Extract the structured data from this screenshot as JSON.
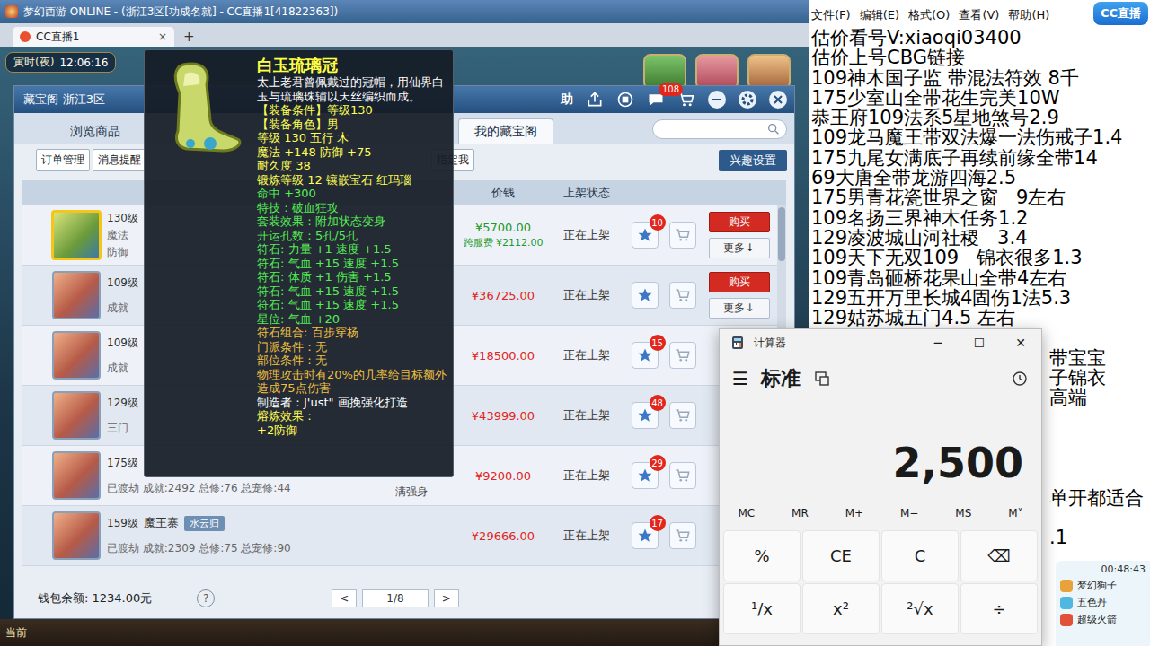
{
  "game": {
    "title": "梦幻西游 ONLINE - (浙江3区[功成名就] - CC直播1[41822363])",
    "browser_tab": "CC直播1",
    "tab_close": "×",
    "new_tab": "+",
    "clock": {
      "period": "寅时(夜)",
      "time": "12:06:16"
    },
    "bottom_label": "当前"
  },
  "cbg": {
    "title": "藏宝阁-浙江3区",
    "help": "助",
    "message_badge": "108",
    "tabs": [
      {
        "label": "浏览商品",
        "selected": false
      },
      {
        "label": "我的藏宝阁",
        "selected": true
      }
    ],
    "sub_tabs": [
      "订单管理",
      "消息提醒",
      "指定我"
    ],
    "interest_button": "兴趣设置",
    "columns": [
      "价钱",
      "上架状态"
    ],
    "rows": [
      {
        "level": "130级",
        "details": [
          "魔法",
          "防御"
        ],
        "price": "¥5700.00",
        "fee": "跨服费 ¥2112.00",
        "price_color": "#1c9a2c",
        "status": "正在上架",
        "favorites": "10",
        "actions": [
          "购买",
          "更多↓"
        ],
        "selected": true
      },
      {
        "level": "109级",
        "details": [
          "成就"
        ],
        "price": "¥36725.00",
        "price_color": "#e2261c",
        "status": "正在上架",
        "actions": [
          "购买",
          "更多↓"
        ],
        "selected": false
      },
      {
        "level": "109级",
        "details": [
          "成就"
        ],
        "price": "¥18500.00",
        "price_color": "#e2261c",
        "status": "正在上架",
        "favorites": "15",
        "actions": [],
        "selected": false
      },
      {
        "level": "129级",
        "details": [
          "三门"
        ],
        "price": "¥43999.00",
        "price_color": "#e2261c",
        "status": "正在上架",
        "favorites": "48",
        "actions": [],
        "selected": false
      },
      {
        "level": "175级",
        "details": [
          "已渡劫 成就:2492 总修:76 总宠修:44"
        ],
        "extra": "满强身",
        "price": "¥9200.00",
        "price_color": "#e2261c",
        "status": "正在上架",
        "favorites": "29",
        "actions": [],
        "selected": false
      },
      {
        "level": "159级",
        "school": "魔王寨",
        "tag": "水云归",
        "details": [
          "已渡劫 成就:2309 总修:75 总宠修:90"
        ],
        "price": "¥29666.00",
        "price_color": "#e2261c",
        "status": "正在上架",
        "favorites": "17",
        "actions": [],
        "selected": false
      }
    ],
    "wallet": "钱包余额: 1234.00元",
    "help_mark": "?",
    "prev": "<",
    "page": "1/8",
    "next": ">"
  },
  "tooltip": {
    "name": "白玉琉璃冠",
    "description": "太上老君曾佩戴过的冠帽，用仙界白玉与琉璃珠辅以天丝编织而成。",
    "lines": [
      {
        "text": "【装备条件】等级130",
        "color": "#ffff55"
      },
      {
        "text": "【装备角色】男",
        "color": "#ffff55"
      },
      {
        "text": "等级 130  五行 木",
        "color": "#ffff55"
      },
      {
        "text": "魔法 +148 防御 +75",
        "color": "#ffff55"
      },
      {
        "text": "耐久度 38",
        "color": "#ffff55"
      },
      {
        "text": "锻炼等级 12  镶嵌宝石 红玛瑙",
        "color": "#ffff55"
      },
      {
        "text": "命中 +300",
        "color": "#55ee55"
      },
      {
        "text": "特技：破血狂攻",
        "color": "#55ee55"
      },
      {
        "text": "套装效果：附加状态变身",
        "color": "#55ee55"
      },
      {
        "text": "开运孔数：5孔/5孔",
        "color": "#55ee55"
      },
      {
        "text": "符石: 力量 +1 速度 +1.5",
        "color": "#55ee55"
      },
      {
        "text": "符石: 气血 +15 速度 +1.5",
        "color": "#55ee55"
      },
      {
        "text": "符石: 体质 +1 伤害 +1.5",
        "color": "#55ee55"
      },
      {
        "text": "符石: 气血 +15 速度 +1.5",
        "color": "#55ee55"
      },
      {
        "text": "符石: 气血 +15 速度 +1.5",
        "color": "#55ee55"
      },
      {
        "text": "星位: 气血 +20",
        "color": "#55ee55"
      },
      {
        "text": "符石组合: 百步穿杨",
        "color": "#f0c040"
      },
      {
        "text": "门派条件：无",
        "color": "#f0c040"
      },
      {
        "text": "部位条件：无",
        "color": "#f0c040"
      },
      {
        "text": "物理攻击时有20%的几率给目标额外造成75点伤害",
        "color": "#f0c040"
      },
      {
        "text": "制造者：J'ust\" 画挽强化打造",
        "color": "#ffffff"
      },
      {
        "text": "熔炼效果：",
        "color": "#ffff55"
      },
      {
        "text": "+2防御",
        "color": "#ffff55"
      }
    ]
  },
  "notepad": {
    "menu": [
      "文件(F)",
      "编辑(E)",
      "格式(O)",
      "查看(V)",
      "帮助(H)"
    ],
    "lines": [
      "估价看号V:xiaoqi03400",
      "估价上号CBG链接",
      "109神木国子监 带混法符效 8千",
      "175少室山全带花生完美10W",
      "恭王府109法系5星地煞号2.9",
      "109龙马魔王带双法爆一法伤戒子1.4",
      "175九尾女满底子再续前缘全带14",
      "69大唐全带龙游四海2.5",
      "175男青花瓷世界之窗   9左右",
      "109名扬三界神木任务1.2",
      "129凌波城山河社稷   3.4",
      "109天下无双109   锦衣很多1.3",
      "109青岛砸桥花果山全带4左右",
      "129五开万里长城4固伤1法5.3",
      "129姑苏城五门4.5 左右"
    ],
    "tail_lines": [
      "带宝宝",
      "子锦衣",
      "高端",
      "单开都适合",
      ".1"
    ]
  },
  "cc_logo": "CC直播",
  "calculator": {
    "title": "计算器",
    "controls": [
      "─",
      "☐",
      "✕"
    ],
    "menu_icon": "☰",
    "mode": "标准",
    "display": "2,500",
    "memory": [
      "MC",
      "MR",
      "M+",
      "M−",
      "MS",
      "M˅"
    ],
    "keys": [
      "%",
      "CE",
      "C",
      "⌫",
      "¹/x",
      "x²",
      "²√x",
      "÷"
    ]
  },
  "live_widget": {
    "timer": "00:48:43",
    "gifts": [
      {
        "name": "梦幻狗子",
        "color": "#e8a23a"
      },
      {
        "name": "五色丹",
        "color": "#4fb7e0"
      },
      {
        "name": "超级火箭",
        "color": "#e0503a"
      }
    ]
  }
}
